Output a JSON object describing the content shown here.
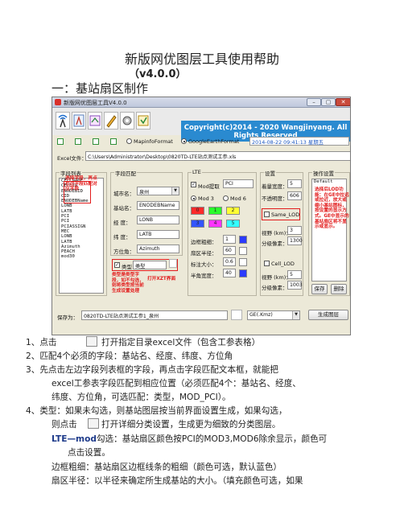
{
  "doc": {
    "title": "新版网优图层工具使用帮助",
    "version": "（v4.0.0）",
    "section": "一：基站扇区制作"
  },
  "app": {
    "window_title": "新版网优图层工具V4.0.0",
    "banner": "Copyright(c)2014 - 2020 Wangjinyang. All Rights Reserved",
    "map_options": [
      "MapinfoFormat",
      "GoogleEarthFormat"
    ],
    "timestamp": "2014-08-22 09:41:13  星期五",
    "excel_label": "Excel文件：",
    "excel_path": "C:\\Users\\Administrator\\Desktop\\0820TD-LTE站点测试工参.xls",
    "field_list": {
      "label": "字段列表",
      "items": [
        "CELLNAME",
        "CELLID",
        "ENODEBID",
        "CID",
        "ENODEBName",
        "LONB",
        "LATB",
        "PCI",
        "PCI",
        "PCIASSIGN",
        "MEC",
        "LONB",
        "LATB",
        "Azimuth",
        "PEACH",
        "mod30"
      ]
    },
    "mapping": {
      "label": "字段匹配",
      "rows": [
        {
          "label": "城市名：",
          "value": "泉州"
        },
        {
          "label": "基站名：",
          "value": "ENODEBName"
        },
        {
          "label": "经 度：",
          "value": "LONB"
        },
        {
          "label": "纬 度：",
          "value": "LATB"
        },
        {
          "label": "方位角：",
          "value": "Azimuth"
        }
      ],
      "type_label": "类型",
      "type_value": "类型"
    },
    "lte": {
      "label": "LTE",
      "mod_label": "Mod提取",
      "mod_value": "PCI",
      "mod_options": [
        "Mod 3",
        "Mod 6"
      ],
      "swatch_numbers": [
        "0",
        "1",
        "2",
        "3",
        "4",
        "5"
      ],
      "swatch_colors": [
        "#ff2a2a",
        "#2aff2a",
        "#ffff33",
        "#3355ff",
        "#ff33ff",
        "#33ffff"
      ],
      "rows": [
        {
          "label": "边框粗细：",
          "value": "1"
        },
        {
          "label": "扇区半径：",
          "value": "60"
        },
        {
          "label": "标注大小：",
          "value": "0.6"
        },
        {
          "label": "半角宽度：",
          "value": "40"
        }
      ]
    },
    "settings": {
      "label": "设置",
      "rows": [
        {
          "label": "着量宽度：",
          "value": "5"
        },
        {
          "label": "不透明度：",
          "value": "606"
        }
      ],
      "same_lod_label": "Same_LOD",
      "view_label": "视野 (km)：",
      "view_value": "3",
      "res_label": "分级像素：",
      "res_value": "1300",
      "cell_lod_label": "Cell_LOD",
      "view2_value": "5",
      "res2_value": "1003"
    },
    "ops": {
      "label": "操作设置",
      "value": "Default",
      "save": "保存",
      "delete": "删除"
    },
    "save_label": "保存为：",
    "save_path": "0820TD-LTE站点测试工参1_泉州",
    "format": "GE(.Kmz)",
    "generate": "生成图层",
    "notes": {
      "field_list": "选择字段，再点右边字段匹配对应字段",
      "right": "选择后LOD功能：在GE中拉远或拉近，放大或缩小基站图标，按设置的显示方式。GE中显示的基站扇区将不显示或显示。",
      "type_note": "类型是类型字段，如不勾选，则将类型按当前生成设置处理",
      "xzt": "打开XZT界面"
    }
  },
  "instructions": {
    "l1_prefix": "1、点击",
    "l1_suffix": "打开指定目录excel文件（包含工参表格）",
    "l2": "2、匹配4个必须的字段：基站名、经度、纬度、方位角",
    "l3a": "3、先点击左边字段列表框的字段，再点击字段匹配文本框，就能把",
    "l3b": "excel工参表字段匹配到相应位置（必须匹配4个：基站名、经度、",
    "l3c": "纬度、方位角，可选匹配：类型，MOD_PCI）。",
    "l4a": "4、类型：如果未勾选，则基站图层按当前界面设置生成，如果勾选，",
    "l4b_prefix": "则点击",
    "l4b_suffix": "打开详细分类设置，生成更为细致的分类图层。",
    "l5_blue": "LTE—mod",
    "l5_rest": "勾选：基站扇区颜色按PCI的MOD3,MOD6除余显示，颜色可",
    "l5b": "点击设置。",
    "l6": "边框粗细：基站扇区边框线条的粗细（颜色可选，默认蓝色）",
    "l7": "扇区半径：以半径来确定所生成基站的大小。（填充颜色可选，如果"
  }
}
